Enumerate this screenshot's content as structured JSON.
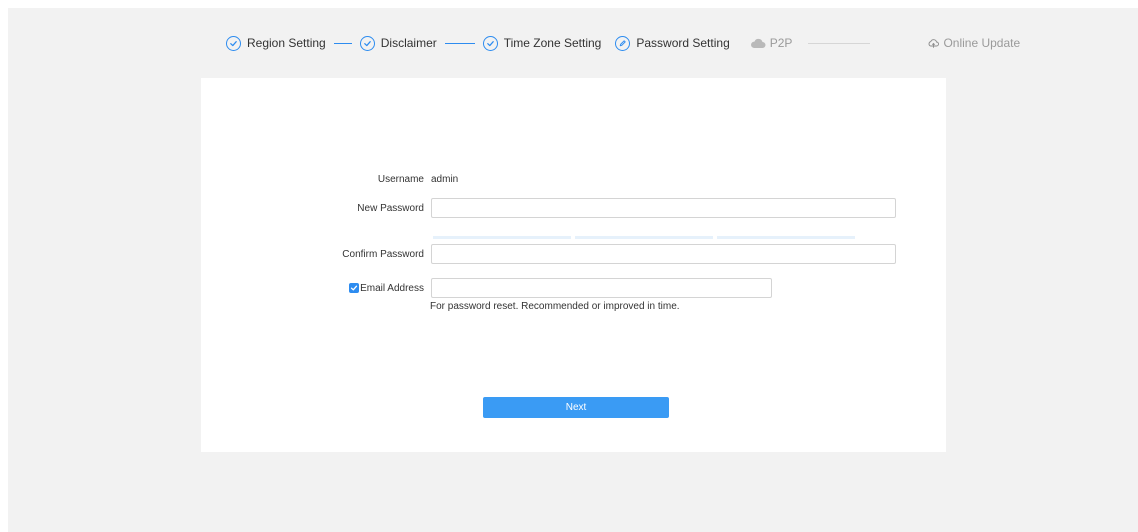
{
  "stepper": {
    "steps": [
      {
        "label": "Region Setting",
        "state": "done",
        "icon": "check-circle-icon"
      },
      {
        "label": "Disclaimer",
        "state": "done",
        "icon": "check-circle-icon"
      },
      {
        "label": "Time Zone Setting",
        "state": "done",
        "icon": "check-circle-icon"
      },
      {
        "label": "Password Setting",
        "state": "active",
        "icon": "pencil-circle-icon"
      },
      {
        "label": "P2P",
        "state": "pending",
        "icon": "cloud-icon"
      },
      {
        "label": "Online Update",
        "state": "pending",
        "icon": "update-icon"
      }
    ]
  },
  "form": {
    "username_label": "Username",
    "username_value": "admin",
    "new_password_label": "New Password",
    "new_password_value": "",
    "confirm_password_label": "Confirm Password",
    "confirm_password_value": "",
    "email_label": "Email Address",
    "email_checked": true,
    "email_value": "",
    "email_hint": "For password reset. Recommended or improved in time."
  },
  "buttons": {
    "next_label": "Next"
  },
  "colors": {
    "accent": "#2d8cf0",
    "button": "#3a9bf4",
    "background": "#f2f2f2",
    "pending_text": "#9a9a9a"
  }
}
